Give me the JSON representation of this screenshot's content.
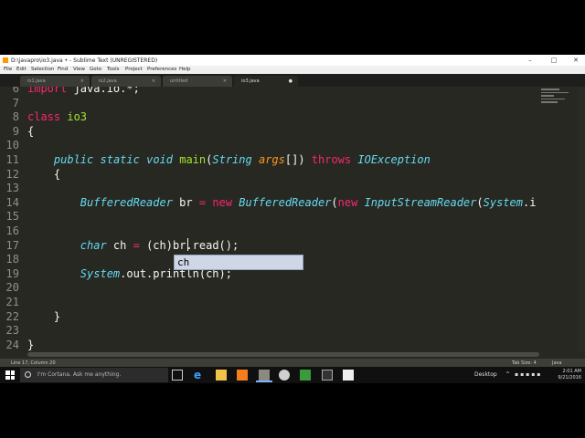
{
  "window": {
    "title": "D:\\javapro\\io3.java • - Sublime Text (UNREGISTERED)",
    "minimize_glyph": "–",
    "maximize_glyph": "□",
    "close_glyph": "✕"
  },
  "menubar": [
    "File",
    "Edit",
    "Selection",
    "Find",
    "View",
    "Goto",
    "Tools",
    "Project",
    "Preferences",
    "Help"
  ],
  "tabs": [
    {
      "label": "io1.java",
      "active": false
    },
    {
      "label": "io2.java",
      "active": false
    },
    {
      "label": "untitled",
      "active": false
    },
    {
      "label": "io3.java",
      "active": true
    }
  ],
  "tab_close_glyph": "×",
  "editor": {
    "lines": [
      {
        "num": "6",
        "tokens": [
          {
            "c": "k",
            "v": "import"
          },
          {
            "c": "",
            "v": " java.io.*;"
          }
        ]
      },
      {
        "num": "7",
        "tokens": []
      },
      {
        "num": "8",
        "tokens": [
          {
            "c": "k",
            "v": "class"
          },
          {
            "c": "",
            "v": " "
          },
          {
            "c": "f",
            "v": "io3"
          }
        ]
      },
      {
        "num": "9",
        "tokens": [
          {
            "c": "",
            "v": "{"
          }
        ]
      },
      {
        "num": "10",
        "tokens": []
      },
      {
        "num": "11",
        "tokens": [
          {
            "c": "",
            "v": "    "
          },
          {
            "c": "t",
            "v": "public"
          },
          {
            "c": "",
            "v": " "
          },
          {
            "c": "t",
            "v": "static"
          },
          {
            "c": "",
            "v": " "
          },
          {
            "c": "t",
            "v": "void"
          },
          {
            "c": "",
            "v": " "
          },
          {
            "c": "f",
            "v": "main"
          },
          {
            "c": "",
            "v": "("
          },
          {
            "c": "t",
            "v": "String"
          },
          {
            "c": "",
            "v": " "
          },
          {
            "c": "p",
            "v": "args"
          },
          {
            "c": "",
            "v": "[]) "
          },
          {
            "c": "k",
            "v": "throws"
          },
          {
            "c": "",
            "v": " "
          },
          {
            "c": "t",
            "v": "IOException"
          }
        ]
      },
      {
        "num": "12",
        "tokens": [
          {
            "c": "",
            "v": "    {"
          }
        ]
      },
      {
        "num": "13",
        "tokens": []
      },
      {
        "num": "14",
        "tokens": [
          {
            "c": "",
            "v": "        "
          },
          {
            "c": "t",
            "v": "BufferedReader"
          },
          {
            "c": "",
            "v": " br "
          },
          {
            "c": "k",
            "v": "="
          },
          {
            "c": "",
            "v": " "
          },
          {
            "c": "k",
            "v": "new"
          },
          {
            "c": "",
            "v": " "
          },
          {
            "c": "t",
            "v": "BufferedReader"
          },
          {
            "c": "",
            "v": "("
          },
          {
            "c": "k",
            "v": "new"
          },
          {
            "c": "",
            "v": " "
          },
          {
            "c": "t",
            "v": "InputStreamReader"
          },
          {
            "c": "",
            "v": "("
          },
          {
            "c": "t",
            "v": "System"
          },
          {
            "c": "",
            "v": ".i"
          }
        ]
      },
      {
        "num": "15",
        "tokens": []
      },
      {
        "num": "16",
        "tokens": []
      },
      {
        "num": "17",
        "tokens": [
          {
            "c": "",
            "v": "        "
          },
          {
            "c": "t",
            "v": "char"
          },
          {
            "c": "",
            "v": " ch "
          },
          {
            "c": "k",
            "v": "="
          },
          {
            "c": "",
            "v": " (ch)br.read();"
          }
        ]
      },
      {
        "num": "18",
        "tokens": []
      },
      {
        "num": "19",
        "tokens": [
          {
            "c": "",
            "v": "        "
          },
          {
            "c": "t",
            "v": "System"
          },
          {
            "c": "",
            "v": ".out.println(ch);"
          }
        ]
      },
      {
        "num": "20",
        "tokens": []
      },
      {
        "num": "21",
        "tokens": []
      },
      {
        "num": "22",
        "tokens": [
          {
            "c": "",
            "v": "    }"
          }
        ]
      },
      {
        "num": "23",
        "tokens": []
      },
      {
        "num": "24",
        "tokens": [
          {
            "c": "",
            "v": "}"
          }
        ]
      }
    ],
    "autocomplete": "ch"
  },
  "statusbar": {
    "left": "Line 17, Column 20",
    "tab_size": "Tab Size: 4",
    "syntax": "Java"
  },
  "taskbar": {
    "search_placeholder": "I'm Cortana. Ask me anything.",
    "desktop_label": "Desktop",
    "time": "2:01 AM",
    "date": "9/21/2016"
  },
  "colors": {
    "editor_bg": "#272822",
    "keyword": "#f92672",
    "type": "#66d9ef",
    "function": "#a6e22e",
    "param": "#fd971f"
  }
}
